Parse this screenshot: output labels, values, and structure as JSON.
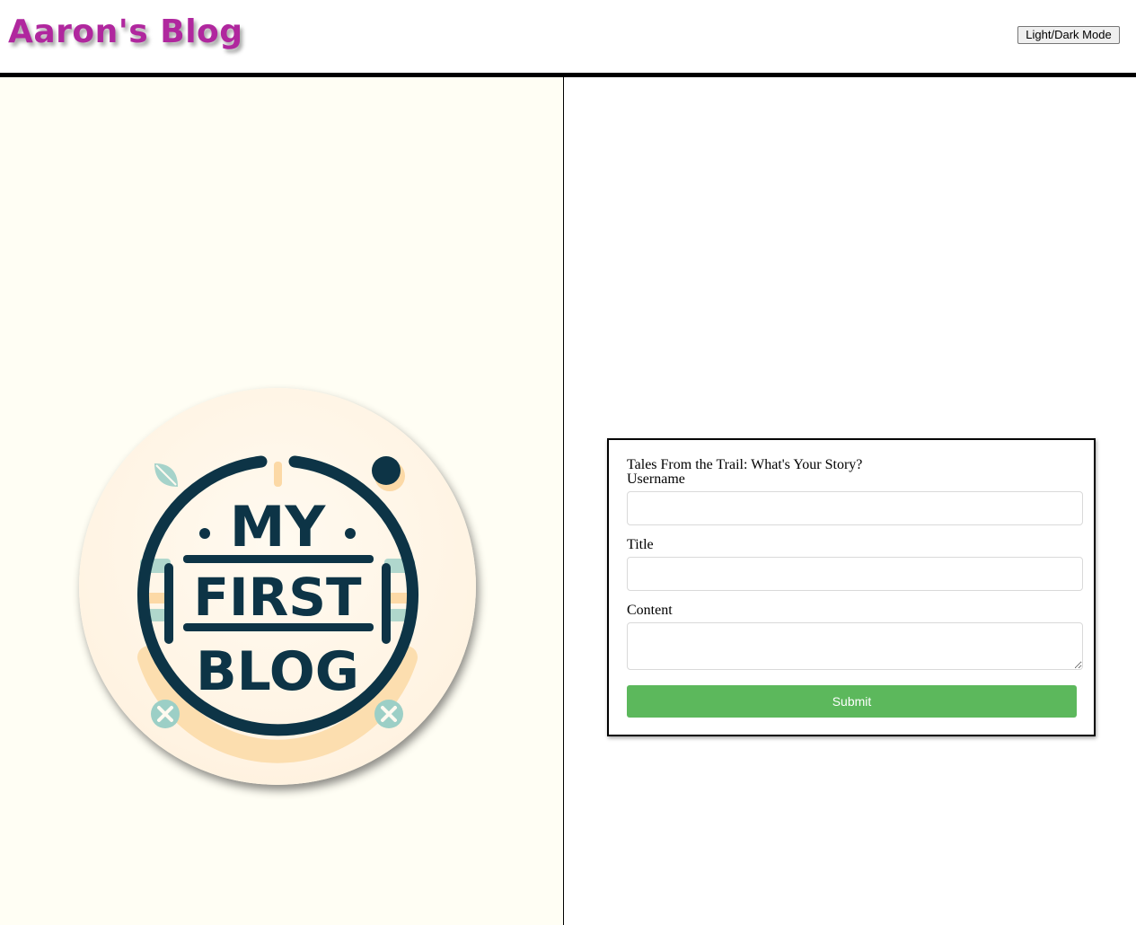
{
  "header": {
    "title": "Aaron's Blog",
    "mode_toggle_label": "Light/Dark Mode"
  },
  "logo": {
    "lines": [
      "MY",
      "FIRST",
      "BLOG"
    ],
    "colors": {
      "ink": "#0d3446",
      "accent_peach": "#fcd9a6",
      "accent_teal": "#9ccfc6"
    }
  },
  "form": {
    "heading": "Tales From the Trail: What's Your Story?",
    "username_label": "Username",
    "username_value": "",
    "title_label": "Title",
    "title_value": "",
    "content_label": "Content",
    "content_value": "",
    "submit_label": "Submit"
  },
  "colors": {
    "title": "#b0279e",
    "left_panel_bg": "#fffef4",
    "submit_bg": "#5cb85c"
  }
}
